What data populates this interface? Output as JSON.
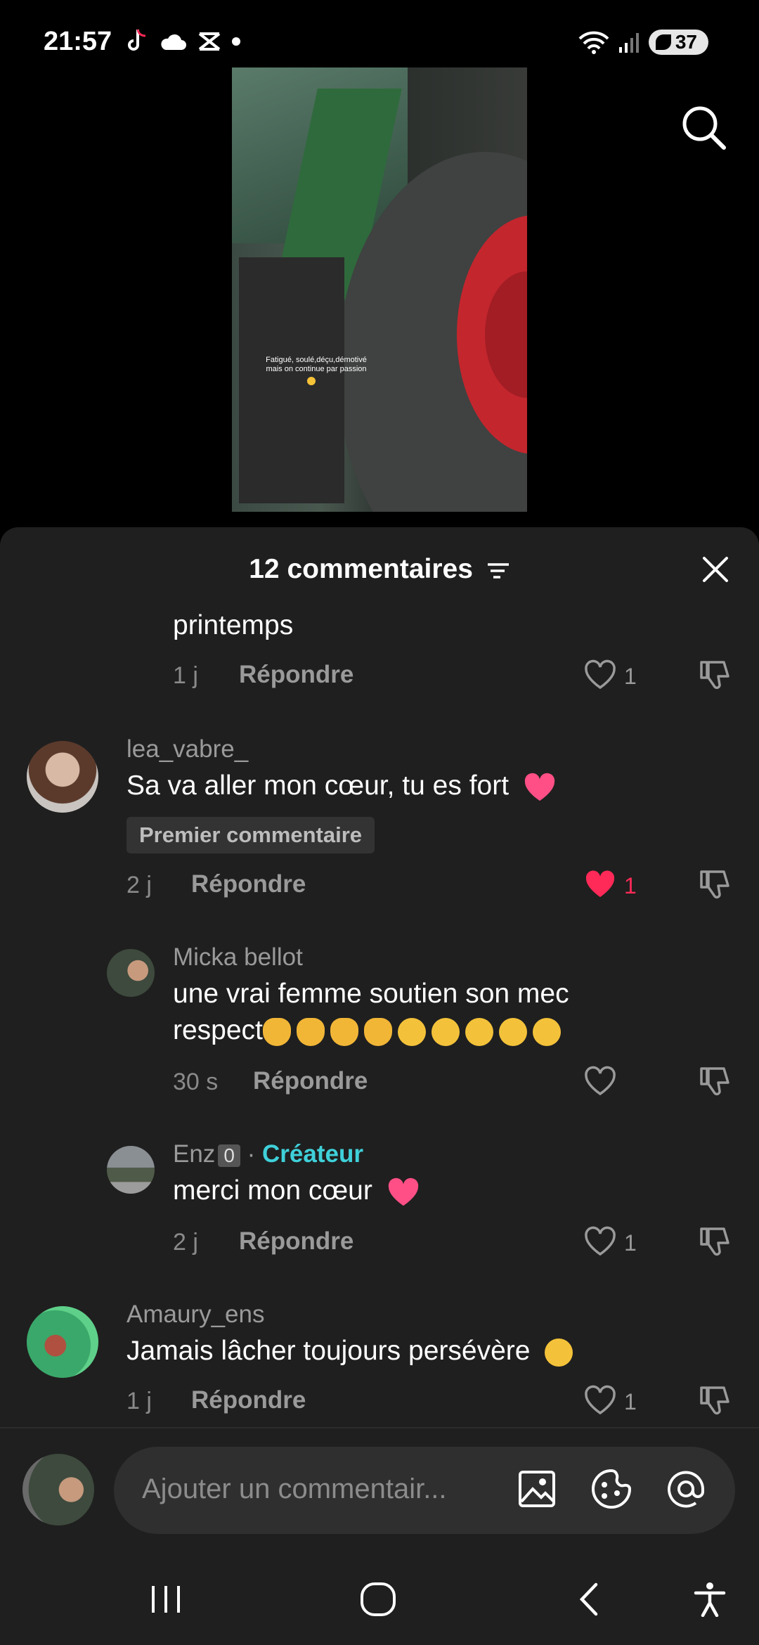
{
  "status_bar": {
    "time": "21:57",
    "battery": "37",
    "icons": [
      "tiktok-icon",
      "cloud-icon",
      "capcut-icon",
      "dot-icon",
      "wifi-icon",
      "signal-icon",
      "battery-icon"
    ]
  },
  "video": {
    "caption_line1": "Fatigué, soulé,déçu,démotivé",
    "caption_line2": "mais on continue par passion"
  },
  "comments_header": {
    "title": "12 commentaires"
  },
  "comments": [
    {
      "text": "printemps",
      "time": "1 j",
      "reply": "Répondre",
      "likes": "1",
      "liked": false
    },
    {
      "username": "lea_vabre_",
      "text": "Sa va aller mon cœur, tu es fort",
      "badge": "Premier commentaire",
      "time": "2 j",
      "reply": "Répondre",
      "likes": "1",
      "liked": true
    },
    {
      "username": "Micka bellot",
      "text_line1": "une vrai femme soutien son mec",
      "text_line2": "respect",
      "time": "30 s",
      "reply": "Répondre",
      "likes": "",
      "liked": false
    },
    {
      "username": "Enz",
      "username_suffix": "0",
      "separator": "·",
      "creator_label": "Créateur",
      "text": "merci mon cœur",
      "time": "2 j",
      "reply": "Répondre",
      "likes": "1",
      "liked": false
    },
    {
      "username": "Amaury_ens",
      "text": "Jamais lâcher toujours persévère",
      "time": "1 j",
      "reply": "Répondre",
      "likes": "1",
      "liked": false
    }
  ],
  "input": {
    "placeholder": "Ajouter un commentair..."
  },
  "colors": {
    "sheet_bg": "#1f1f1f",
    "heart_red": "#ff2a57",
    "creator_teal": "#3fd0d9",
    "muted_text": "#9a9a9a"
  }
}
